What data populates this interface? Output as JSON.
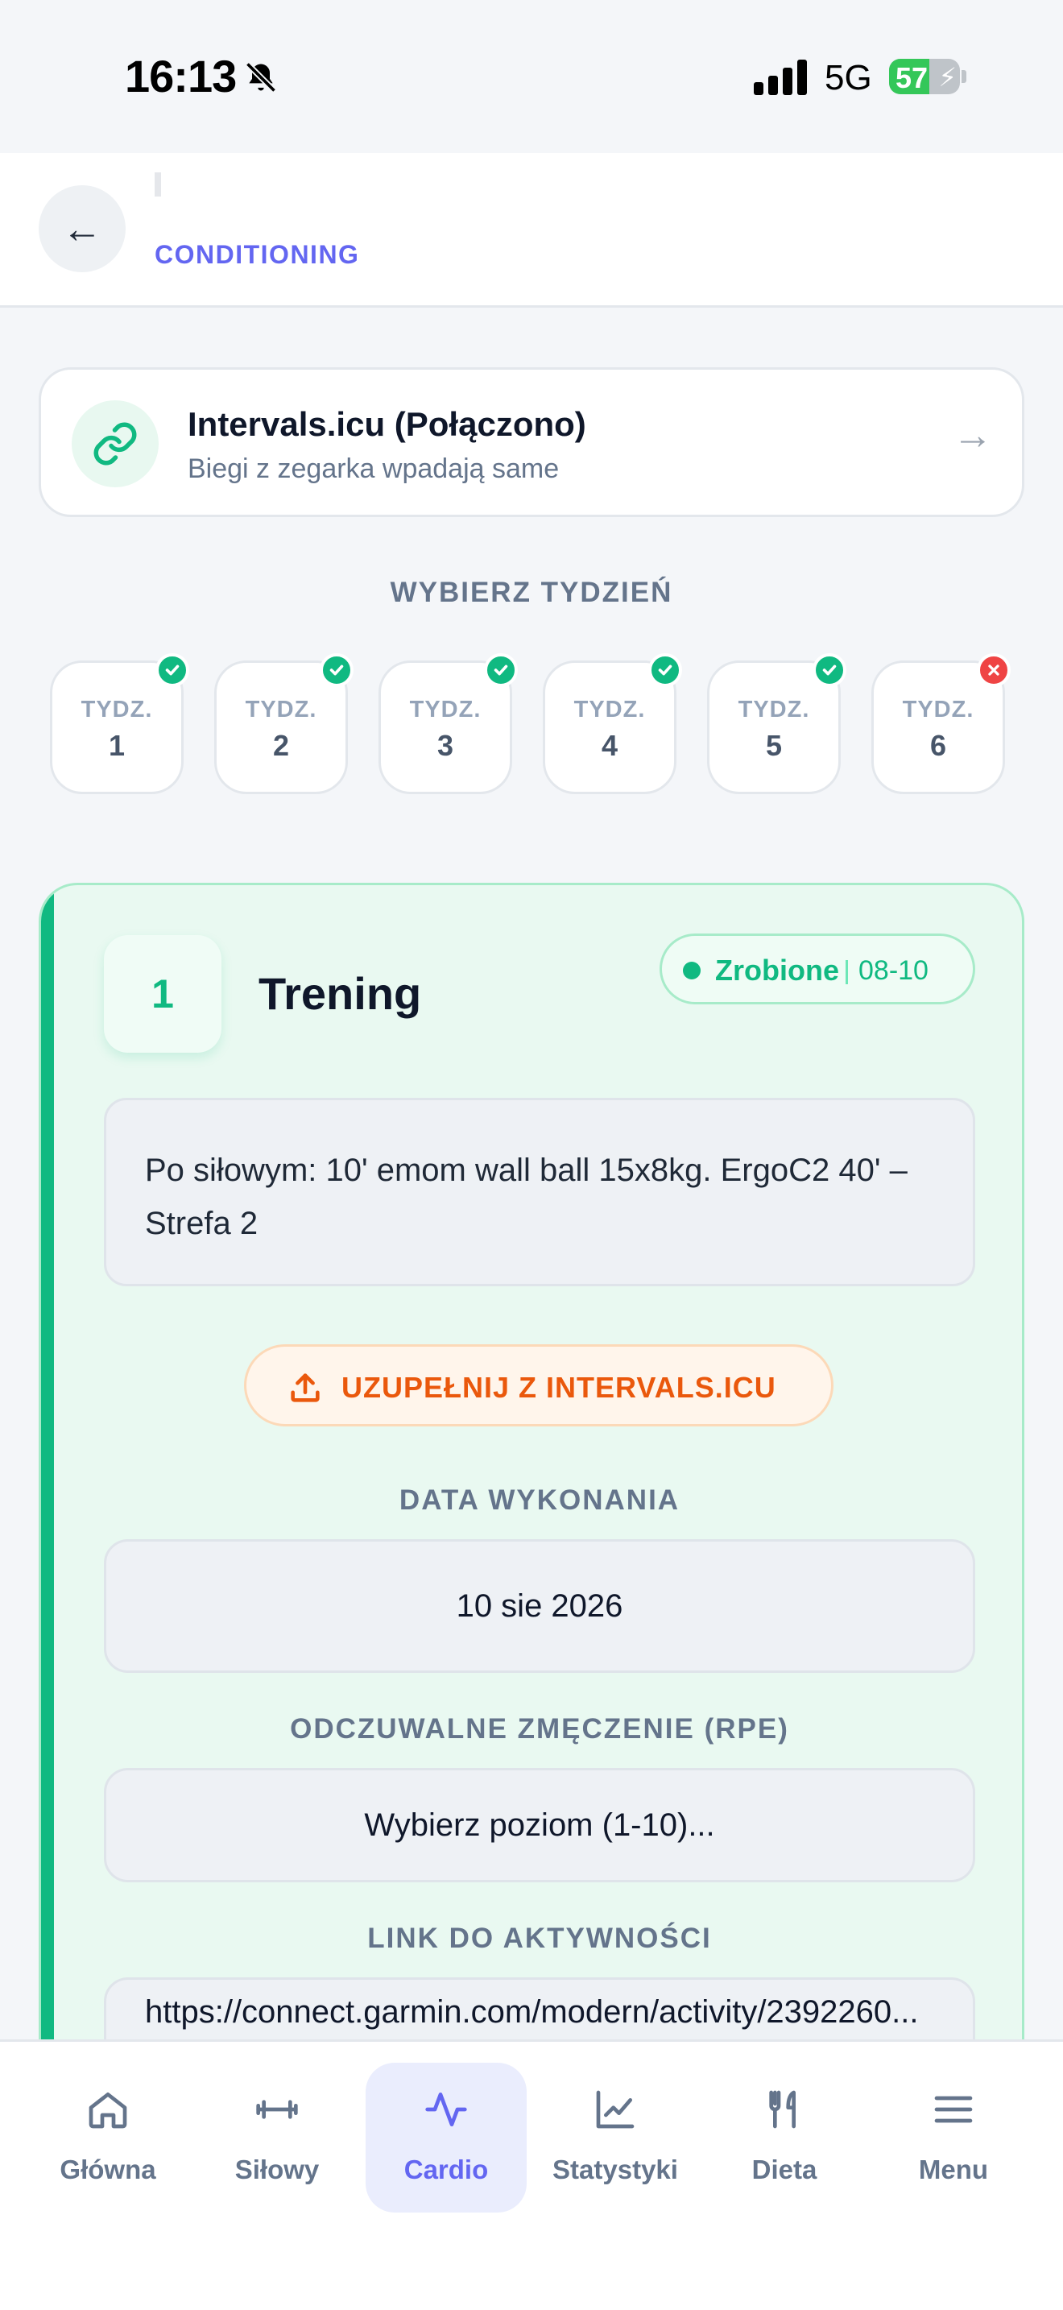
{
  "status_bar": {
    "time": "16:13",
    "network": "5G",
    "battery": "57",
    "battery_level": 0.57
  },
  "header": {
    "subtitle": "CONDITIONING",
    "back_glyph": "←"
  },
  "intervals": {
    "title": "Intervals.icu (Połączono)",
    "subtitle": "Biegi z zegarka wpadają same",
    "arrow": "→"
  },
  "week_picker": {
    "title": "WYBIERZ TYDZIEŃ",
    "weeks": [
      {
        "label": "TYDZ.",
        "number": "1",
        "status": "done"
      },
      {
        "label": "TYDZ.",
        "number": "2",
        "status": "done"
      },
      {
        "label": "TYDZ.",
        "number": "3",
        "status": "done"
      },
      {
        "label": "TYDZ.",
        "number": "4",
        "status": "done"
      },
      {
        "label": "TYDZ.",
        "number": "5",
        "status": "done"
      },
      {
        "label": "TYDZ.",
        "number": "6",
        "status": "missed"
      }
    ]
  },
  "training": {
    "number": "1",
    "title": "Trening",
    "status": "Zrobione",
    "date_short": "08-10",
    "description": "Po siłowym: 10' emom wall ball 15x8kg. ErgoC2 40' – Strefa 2",
    "upload_label": "UZUPEŁNIJ Z INTERVALS.ICU",
    "date_label": "DATA WYKONANIA",
    "date_value": "10 sie 2026",
    "rpe_label": "ODCZUWALNE ZMĘCZENIE (RPE)",
    "rpe_placeholder": "Wybierz poziom (1-10)...",
    "link_label": "LINK DO AKTYWNOŚCI",
    "link_value": "https://connect.garmin.com/modern/activity/2392260..."
  },
  "colors": {
    "accent": "#6366f1",
    "success": "#10b981",
    "warning": "#ea580c",
    "error": "#ef4444"
  },
  "bottom_nav": {
    "items": [
      {
        "label": "Główna",
        "icon": "home-icon",
        "active": false
      },
      {
        "label": "Siłowy",
        "icon": "dumbbell-icon",
        "active": false
      },
      {
        "label": "Cardio",
        "icon": "pulse-icon",
        "active": true
      },
      {
        "label": "Statystyki",
        "icon": "chart-icon",
        "active": false
      },
      {
        "label": "Dieta",
        "icon": "cutlery-icon",
        "active": false
      },
      {
        "label": "Menu",
        "icon": "menu-icon",
        "active": false
      }
    ]
  }
}
